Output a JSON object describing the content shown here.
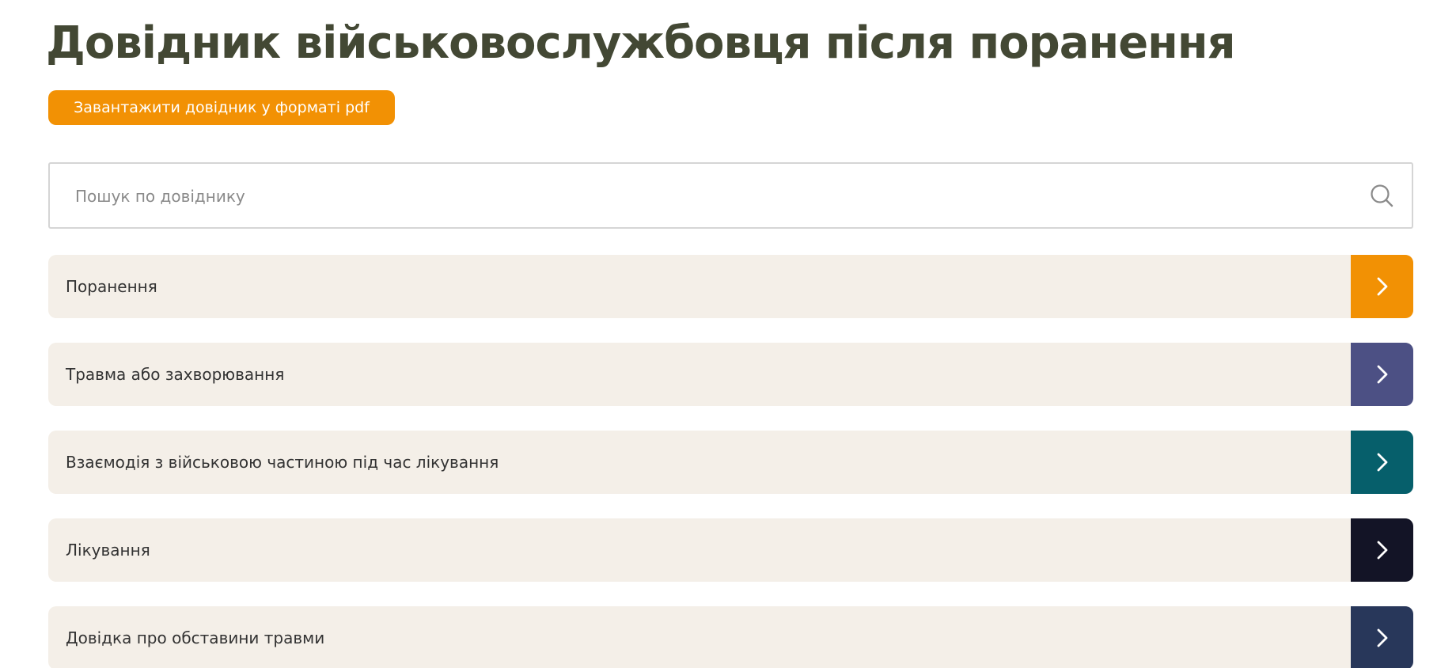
{
  "page": {
    "title": "Довідник військовослужбовця після поранення",
    "pdf_button_label": "Завантажити довідник у форматі pdf"
  },
  "search": {
    "placeholder": "Пошук по довіднику",
    "icon": "search-icon"
  },
  "topics": [
    {
      "label": "Поранення",
      "accent": "#f29104",
      "icon": "chevron-right-icon"
    },
    {
      "label": "Травма або захворювання",
      "accent": "#4c5084",
      "icon": "chevron-right-icon"
    },
    {
      "label": "Взаємодія з військовою частиною під час лікування",
      "accent": "#065f6b",
      "icon": "chevron-right-icon"
    },
    {
      "label": "Лікування",
      "accent": "#131426",
      "icon": "chevron-right-icon"
    },
    {
      "label": "Довідка про обставини травми",
      "accent": "#28375a",
      "icon": "chevron-right-icon"
    }
  ],
  "colors": {
    "title": "#434834",
    "button": "#f29104",
    "topic_background": "#f4efe8"
  }
}
